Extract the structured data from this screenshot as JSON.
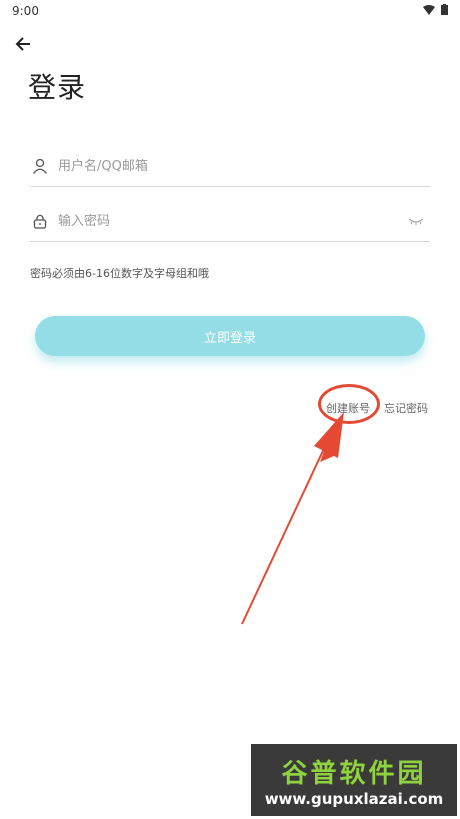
{
  "status_bar": {
    "time": "9:00"
  },
  "header": {
    "title": "登录"
  },
  "form": {
    "username_placeholder": "用户名/QQ邮箱",
    "password_placeholder": "输入密码",
    "hint": "密码必须由6-16位数字及字母组和哦",
    "login_label": "立即登录"
  },
  "links": {
    "create_account": "创建账号",
    "forgot_password": "忘记密码"
  },
  "watermark": {
    "brand": "谷普软件园",
    "url": "www.gupuxlazai.com"
  },
  "colors": {
    "button": "#92dde6",
    "annotation": "#e44a33",
    "watermark_text": "#8fd13f"
  }
}
